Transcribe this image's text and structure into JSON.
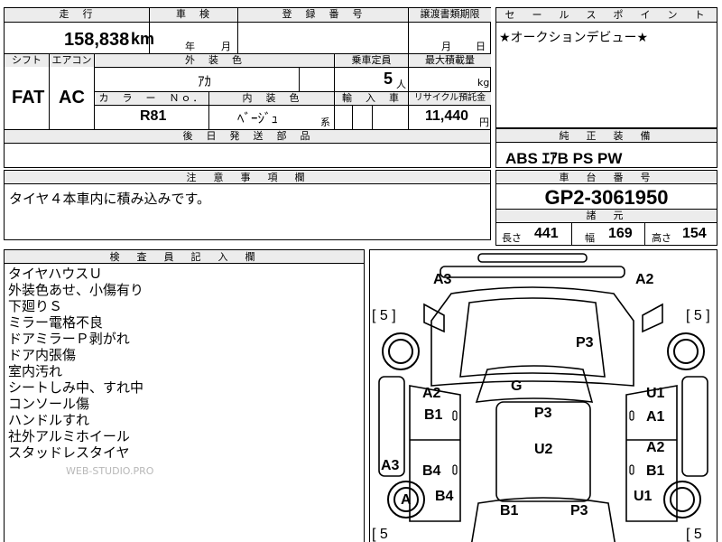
{
  "row1": {
    "mileage_label": "走　行",
    "mileage_value": "158,838",
    "mileage_unit": "km",
    "inspection_label": "車　検",
    "year_label": "年",
    "month_label": "月",
    "reg_label": "登　録　番　号",
    "transfer_label": "譲渡書類期限",
    "transfer_month": "月",
    "transfer_day": "日"
  },
  "row2": {
    "shift_label": "シフト",
    "shift_value": "FAT",
    "ac_label": "エアコン",
    "ac_value": "AC",
    "ext_color_label": "外　装　色",
    "ext_color_value": "ｱｶ",
    "capacity_label": "乗車定員",
    "capacity_value": "5",
    "capacity_unit": "人",
    "max_load_label": "最大積載量",
    "max_load_unit": "kg",
    "color_no_label": "カ　ラ　ー　Ｎｏ．",
    "color_no_value": "R81",
    "int_color_label": "内　装　色",
    "int_color_value": "ﾍﾞｰｼﾞｭ",
    "int_color_suffix": "系",
    "import_label": "輸　入　車",
    "recycle_label": "リサイクル預託金",
    "recycle_value": "11,440",
    "recycle_unit": "円"
  },
  "later_parts_label": "後　日　発　送　部　品",
  "sales_point": {
    "label": "セ　ー　ル　ス　ポ　イ　ン　ト",
    "text": "★オークションデビュー★"
  },
  "equipment": {
    "label": "純　正　装　備",
    "text": "ABS ｴｱB PS PW"
  },
  "notes": {
    "label": "注　意　事　項　欄",
    "text": "タイヤ４本車内に積み込みです。"
  },
  "chassis": {
    "label": "車　台　番　号",
    "value": "GP2-3061950"
  },
  "specs": {
    "label": "諸　元",
    "length_label": "長さ",
    "length_value": "441",
    "width_label": "幅",
    "width_value": "169",
    "height_label": "高さ",
    "height_value": "154"
  },
  "inspector": {
    "label": "検　査　員　記　入　欄",
    "lines": [
      "タイヤハウスＵ",
      "外装色あせ、小傷有り",
      "下廻りＳ",
      "ミラー電格不良",
      "ドアミラーＰ剥がれ",
      "ドア内張傷",
      "室内汚れ",
      "シートしみ中、すれ中",
      "コンソール傷",
      "ハンドルすれ",
      "社外アルミホイール",
      "スタッドレスタイヤ"
    ],
    "watermark": "WEB-STUDIO.PRO"
  },
  "diagram": {
    "tire_fl": "[ 5 ]",
    "tire_fr": "[ 5 ]",
    "tire_rl": "[ 5",
    "tire_rr": "[ 5",
    "marks": {
      "a3_top": "A3",
      "a2_top": "A2",
      "p3_bonnet": "P3",
      "g_glass": "G",
      "a2_left_front": "A2",
      "b1_left_front": "B1",
      "u1_right_front": "U1",
      "a1_right_front": "A1",
      "p3_roof": "P3",
      "u2_roof": "U2",
      "a2_right_rear": "A2",
      "b1_right_rear": "B1",
      "a3_left_side": "A3",
      "b4_left_rear": "B4",
      "b4_left_lower": "B4",
      "a_wheel": "A",
      "u1_right_lower": "U1",
      "b1_rear": "B1",
      "p3_rear": "P3"
    }
  }
}
